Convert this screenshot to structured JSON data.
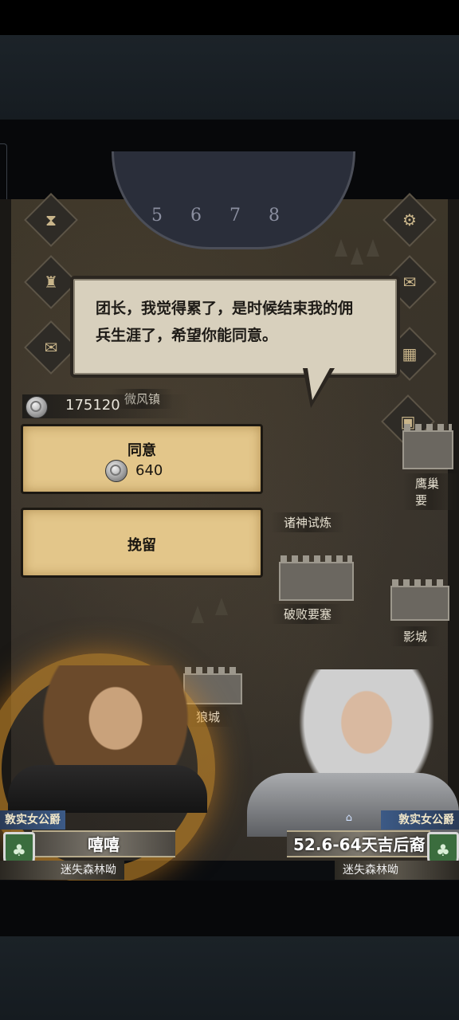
{
  "dialog": {
    "text": "团长，我觉得累了，是时候结束我的佣兵生涯了，希望你能同意。"
  },
  "balance": {
    "icon": "silver-coin-icon",
    "value": "175120"
  },
  "options": {
    "agree": {
      "label": "同意",
      "cost": "640",
      "cost_icon": "silver-coin-icon"
    },
    "retain": {
      "label": "挽留"
    }
  },
  "map": {
    "dial_numbers": "5 6 7 8",
    "labels": {
      "town1": "微风镇",
      "trial": "诸神试炼",
      "fortress": "破败要塞",
      "wolf_city": "狼城",
      "eagle_nest": "鹰巢要",
      "city_right": "影城"
    }
  },
  "left_character": {
    "title": "敦实女公爵",
    "name": "嘻嘻",
    "region": "迷失森林呦",
    "emblem_icon": "tree-shield-icon"
  },
  "right_character": {
    "title": "敦实女公爵",
    "name": "52.6-64天吉后裔",
    "region": "迷失森林呦",
    "emblem_icon": "tree-shield-icon",
    "home_icon": "home-icon"
  },
  "colors": {
    "parchment": "#e3c68a",
    "bubble": "#d8d0bd",
    "title_blue": "#3c5a86",
    "glow": "#dc9628"
  }
}
